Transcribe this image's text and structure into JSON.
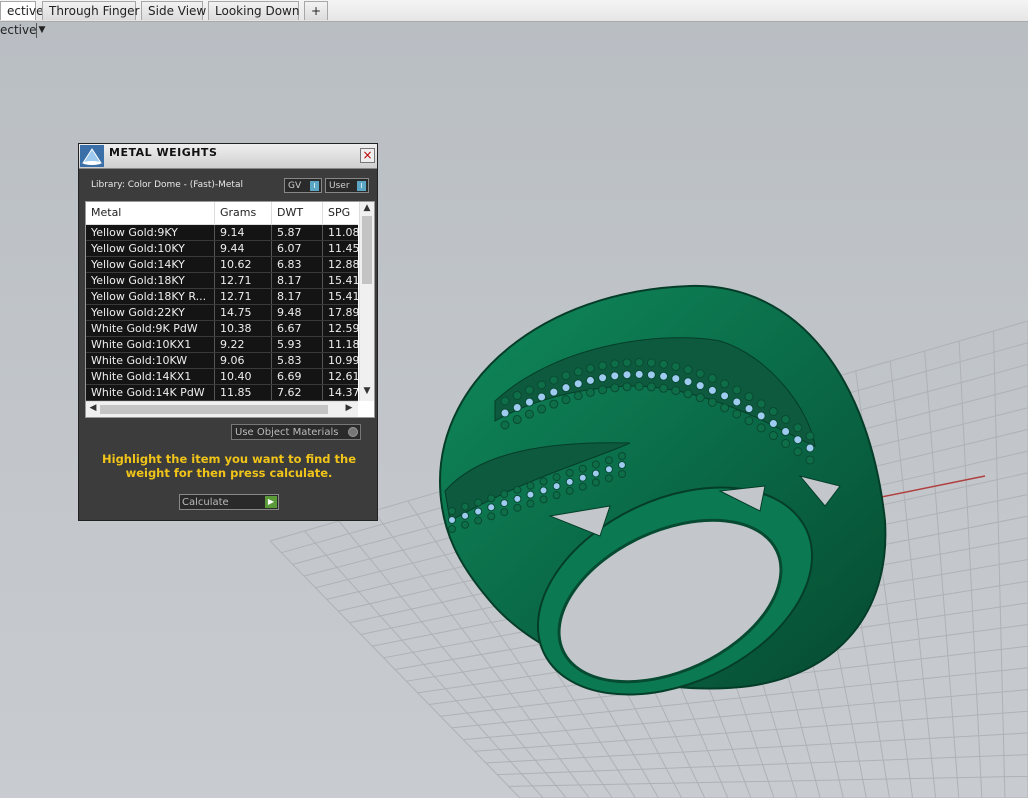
{
  "tabs": [
    {
      "label": "ective",
      "active": true
    },
    {
      "label": "Through Finger",
      "active": false
    },
    {
      "label": "Side View",
      "active": false
    },
    {
      "label": "Looking Down",
      "active": false
    },
    {
      "label": "+",
      "active": false
    }
  ],
  "viewport": {
    "label": "ective"
  },
  "dialog": {
    "title": "METAL WEIGHTS",
    "close_glyph": "×",
    "library_label": "Library: Color Dome - (Fast)-Metal",
    "toggle_gv": "GV",
    "toggle_user": "User",
    "columns": [
      "Metal",
      "Grams",
      "DWT",
      "SPG"
    ],
    "rows": [
      [
        "Yellow Gold:9KY",
        "9.14",
        "5.87",
        "11.08"
      ],
      [
        "Yellow Gold:10KY",
        "9.44",
        "6.07",
        "11.45"
      ],
      [
        "Yellow Gold:14KY",
        "10.62",
        "6.83",
        "12.88"
      ],
      [
        "Yellow Gold:18KY",
        "12.71",
        "8.17",
        "15.41"
      ],
      [
        "Yellow Gold:18KY R...",
        "12.71",
        "8.17",
        "15.41"
      ],
      [
        "Yellow Gold:22KY",
        "14.75",
        "9.48",
        "17.89"
      ],
      [
        "White Gold:9K PdW",
        "10.38",
        "6.67",
        "12.59"
      ],
      [
        "White Gold:10KX1",
        "9.22",
        "5.93",
        "11.18"
      ],
      [
        "White Gold:10KW",
        "9.06",
        "5.83",
        "10.99"
      ],
      [
        "White Gold:14KX1",
        "10.40",
        "6.69",
        "12.61"
      ],
      [
        "White Gold:14K PdW",
        "11.85",
        "7.62",
        "14.37"
      ]
    ],
    "use_object_materials": "Use Object Materials",
    "hint": "Highlight the item you want to find the weight for then press calculate.",
    "calculate_label": "Calculate"
  },
  "colors": {
    "ring_green": "#0a6b48",
    "hint_yellow": "#f0c419",
    "dialog_bg": "#3c3c3c"
  }
}
